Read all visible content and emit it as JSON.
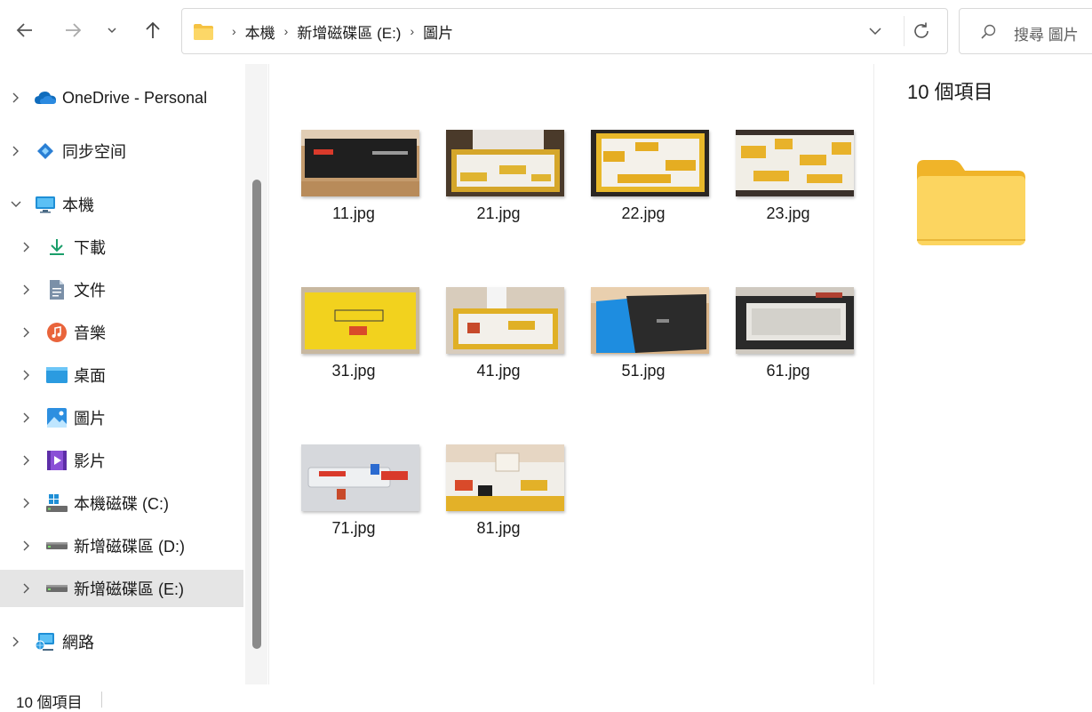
{
  "toolbar": {
    "back_icon": "arrow-left-icon",
    "forward_icon": "arrow-right-icon",
    "recent_icon": "chevron-down-icon",
    "up_icon": "arrow-up-icon"
  },
  "address_bar": {
    "breadcrumbs": [
      "本機",
      "新增磁碟區 (E:)",
      "圖片"
    ],
    "separator": "›"
  },
  "search": {
    "placeholder": "搜尋 圖片"
  },
  "sidebar": {
    "items": [
      {
        "label": "OneDrive - Personal",
        "icon": "onedrive-cloud-icon",
        "expanded": false
      },
      {
        "label": "同步空间",
        "icon": "sync-space-icon",
        "expanded": false
      },
      {
        "label": "本機",
        "icon": "monitor-icon",
        "expanded": true
      },
      {
        "label": "下載",
        "icon": "download-icon",
        "expanded": false
      },
      {
        "label": "文件",
        "icon": "document-icon",
        "expanded": false
      },
      {
        "label": "音樂",
        "icon": "music-icon",
        "expanded": false
      },
      {
        "label": "桌面",
        "icon": "desktop-icon",
        "expanded": false
      },
      {
        "label": "圖片",
        "icon": "pictures-icon",
        "expanded": false
      },
      {
        "label": "影片",
        "icon": "videos-icon",
        "expanded": false
      },
      {
        "label": "本機磁碟 (C:)",
        "icon": "windows-drive-icon",
        "expanded": false
      },
      {
        "label": "新增磁碟區 (D:)",
        "icon": "drive-icon",
        "expanded": false
      },
      {
        "label": "新增磁碟區 (E:)",
        "icon": "drive-icon",
        "expanded": false,
        "selected": true
      },
      {
        "label": "網路",
        "icon": "network-icon",
        "expanded": false
      }
    ]
  },
  "files": [
    {
      "name": "11.jpg",
      "thumb": "black-box"
    },
    {
      "name": "21.jpg",
      "thumb": "keyboard-yellow"
    },
    {
      "name": "22.jpg",
      "thumb": "keyboard-top"
    },
    {
      "name": "23.jpg",
      "thumb": "keyboard-top-2"
    },
    {
      "name": "31.jpg",
      "thumb": "yellow-box"
    },
    {
      "name": "41.jpg",
      "thumb": "keyboard-box"
    },
    {
      "name": "51.jpg",
      "thumb": "blue-black-box"
    },
    {
      "name": "61.jpg",
      "thumb": "gray-keyboard"
    },
    {
      "name": "71.jpg",
      "thumb": "switches"
    },
    {
      "name": "81.jpg",
      "thumb": "keycaps-close"
    }
  ],
  "details": {
    "title": "10 個項目",
    "icon": "folder-large-icon"
  },
  "status_bar": {
    "item_count": "10 個項目"
  },
  "colors": {
    "folder": "#f7c948",
    "selected_bg": "#e5e5e5",
    "onedrive": "#0f6cbd"
  }
}
